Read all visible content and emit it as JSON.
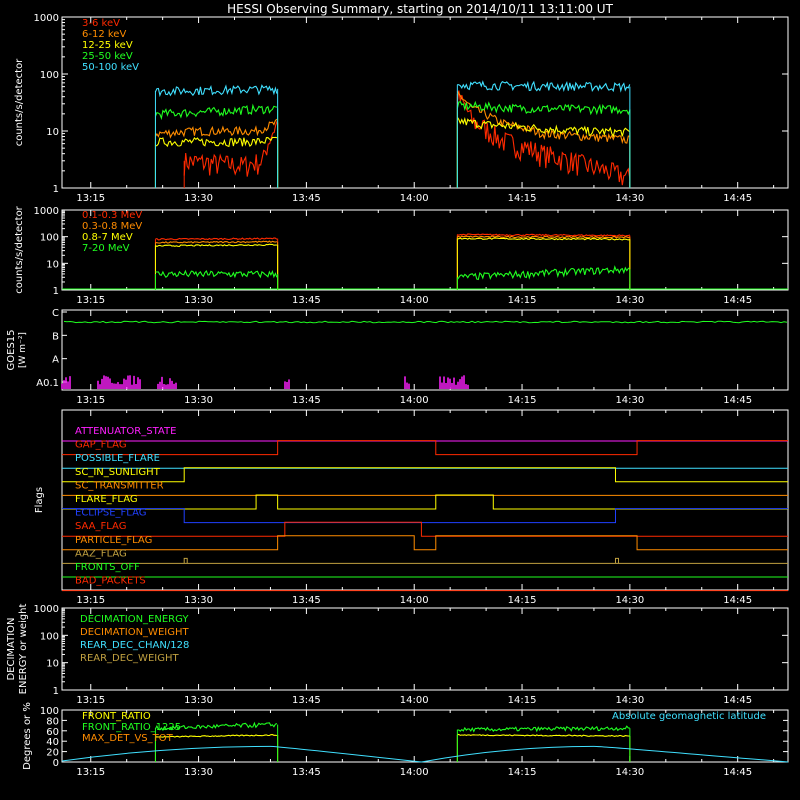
{
  "title": "HESSI Observing Summary, starting on 2014/10/11 13:11:00 UT",
  "time_ticks": [
    "13:15",
    "13:30",
    "13:45",
    "14:00",
    "14:15",
    "14:30",
    "14:45"
  ],
  "colors": {
    "red": "#ff2a00",
    "orange": "#ff8c00",
    "yellow": "#ffff00",
    "green": "#20ff20",
    "cyan": "#40e0ff",
    "magenta": "#ff20ff",
    "blue": "#2040ff",
    "olive": "#c0a040",
    "white": "#ffffff",
    "axis": "#ffffff"
  },
  "chart_data": [
    {
      "type": "line",
      "panel": "low_energy_counts",
      "ylabel": "counts/s/detector",
      "ylog": true,
      "ylim": [
        1,
        1000
      ],
      "yticks": [
        "1",
        "10",
        "100",
        "1000"
      ],
      "xlim_minutes": [
        13.183,
        14.867
      ],
      "legend": [
        "3-6 keV",
        "6-12 keV",
        "12-25 keV",
        "25-50 keV",
        "50-100 keV"
      ],
      "series": [
        {
          "name": "3-6 keV",
          "color": "red",
          "segments": [
            {
              "t": [
                "13:28",
                "13:36",
                "13:39",
                "13:40",
                "13:41"
              ],
              "y": [
                3,
                2.5,
                3,
                8,
                14
              ]
            },
            {
              "t": [
                "14:06",
                "14:08",
                "14:12",
                "14:18",
                "14:24",
                "14:30"
              ],
              "y": [
                40,
                15,
                7,
                4,
                2.5,
                1.5
              ]
            }
          ]
        },
        {
          "name": "6-12 keV",
          "color": "orange",
          "segments": [
            {
              "t": [
                "13:24",
                "13:30",
                "13:38",
                "13:41"
              ],
              "y": [
                9,
                10,
                10,
                14
              ]
            },
            {
              "t": [
                "14:06",
                "14:08",
                "14:12",
                "14:18",
                "14:24",
                "14:30"
              ],
              "y": [
                45,
                25,
                14,
                9,
                8,
                7
              ]
            }
          ]
        },
        {
          "name": "12-25 keV",
          "color": "yellow",
          "segments": [
            {
              "t": [
                "13:24",
                "13:30",
                "13:38",
                "13:41"
              ],
              "y": [
                6.5,
                6.5,
                6.5,
                7
              ]
            },
            {
              "t": [
                "14:06",
                "14:10",
                "14:18",
                "14:24",
                "14:30"
              ],
              "y": [
                15,
                13,
                11,
                10,
                9.5
              ]
            }
          ]
        },
        {
          "name": "25-50 keV",
          "color": "green",
          "segments": [
            {
              "t": [
                "13:24",
                "13:32",
                "13:41"
              ],
              "y": [
                20,
                22,
                25
              ]
            },
            {
              "t": [
                "14:06",
                "14:15",
                "14:30"
              ],
              "y": [
                28,
                25,
                24
              ]
            }
          ]
        },
        {
          "name": "50-100 keV",
          "color": "cyan",
          "segments": [
            {
              "t": [
                "13:24",
                "13:32",
                "13:41"
              ],
              "y": [
                50,
                52,
                55
              ]
            },
            {
              "t": [
                "14:06",
                "14:15",
                "14:30"
              ],
              "y": [
                65,
                62,
                60
              ]
            }
          ]
        }
      ]
    },
    {
      "type": "line",
      "panel": "high_energy_counts",
      "ylabel": "counts/s/detector",
      "ylog": true,
      "ylim": [
        1,
        1000
      ],
      "yticks": [
        "1",
        "10",
        "100",
        "1000"
      ],
      "legend": [
        "0.1-0.3 MeV",
        "0.3-0.8 MeV",
        "0.8-7 MeV",
        "7-20 MeV"
      ],
      "series": [
        {
          "name": "0.1-0.3 MeV",
          "color": "red",
          "segments": [
            {
              "t": [
                "13:24",
                "13:41"
              ],
              "y": [
                80,
                85
              ]
            },
            {
              "t": [
                "14:06",
                "14:30"
              ],
              "y": [
                120,
                110
              ]
            }
          ]
        },
        {
          "name": "0.3-0.8 MeV",
          "color": "orange",
          "segments": [
            {
              "t": [
                "13:24",
                "13:41"
              ],
              "y": [
                60,
                65
              ]
            },
            {
              "t": [
                "14:06",
                "14:30"
              ],
              "y": [
                100,
                95
              ]
            }
          ]
        },
        {
          "name": "0.8-7 MeV",
          "color": "yellow",
          "segments": [
            {
              "t": [
                "13:24",
                "13:41"
              ],
              "y": [
                45,
                50
              ]
            },
            {
              "t": [
                "14:06",
                "14:30"
              ],
              "y": [
                85,
                80
              ]
            }
          ]
        },
        {
          "name": "7-20 MeV",
          "color": "green",
          "segments": [
            {
              "t": [
                "13:24",
                "13:41"
              ],
              "y": [
                4,
                4
              ]
            },
            {
              "t": [
                "14:06",
                "14:15",
                "14:30"
              ],
              "y": [
                3,
                4,
                6
              ]
            }
          ]
        }
      ]
    },
    {
      "type": "line",
      "panel": "goes",
      "ylabel": "GOES15",
      "ylabel2": "[W m⁻²]",
      "yticks": [
        "A0.1",
        "A",
        "B",
        "C"
      ],
      "series": [
        {
          "name": "",
          "color": "green",
          "level": 0.88
        },
        {
          "name": "",
          "color": "magenta",
          "bars": true
        }
      ]
    },
    {
      "type": "table",
      "panel": "flags",
      "ylabel": "Flags",
      "flags": [
        {
          "name": "ATTENUATOR_STATE",
          "color": "magenta",
          "states": [
            0
          ]
        },
        {
          "name": "GAP_FLAG",
          "color": "red",
          "changes": [
            "13:41",
            "14:03",
            "14:31"
          ],
          "states": [
            0,
            1,
            0,
            1
          ]
        },
        {
          "name": "POSSIBLE_FLARE",
          "color": "cyan",
          "states": [
            0
          ]
        },
        {
          "name": "SC_IN_SUNLIGHT",
          "color": "yellow",
          "changes": [
            "13:28",
            "14:28"
          ],
          "states": [
            0,
            1,
            0
          ]
        },
        {
          "name": "SC_TRANSMITTER",
          "color": "orange",
          "states": [
            0
          ]
        },
        {
          "name": "FLARE_FLAG",
          "color": "yellow",
          "changes": [
            "13:38",
            "13:41",
            "14:03",
            "14:11"
          ],
          "states": [
            0,
            1,
            0,
            1,
            0
          ]
        },
        {
          "name": "ECLIPSE_FLAG",
          "color": "blue",
          "changes": [
            "13:28",
            "14:28"
          ],
          "states": [
            1,
            0,
            1
          ]
        },
        {
          "name": "SAA_FLAG",
          "color": "red",
          "changes": [
            "13:42",
            "14:01"
          ],
          "states": [
            0,
            1,
            0
          ]
        },
        {
          "name": "PARTICLE_FLAG",
          "color": "orange",
          "changes": [
            "13:41",
            "14:00",
            "14:03",
            "14:31"
          ],
          "states": [
            0,
            1,
            0,
            1,
            0
          ]
        },
        {
          "name": "AAZ_FLAG",
          "color": "olive",
          "spikes": [
            "13:28",
            "14:28"
          ]
        },
        {
          "name": "FRONTS_OFF",
          "color": "green",
          "states": [
            0
          ]
        },
        {
          "name": "BAD_PACKETS",
          "color": "red",
          "states": [
            0
          ]
        }
      ]
    },
    {
      "type": "line",
      "panel": "decimation",
      "ylabel": "DECIMATION",
      "ylabel2": "ENERGY or weight",
      "ylog": true,
      "ylim": [
        1,
        1000
      ],
      "yticks": [
        "1",
        "10",
        "100",
        "1000"
      ],
      "legend": [
        "DECIMATION_ENERGY",
        "DECIMATION_WEIGHT",
        "REAR_DEC_CHAN/128",
        "REAR_DEC_WEIGHT"
      ],
      "legend_colors": [
        "green",
        "orange",
        "cyan",
        "olive"
      ]
    },
    {
      "type": "line",
      "panel": "ratios",
      "ylabel": "Degrees or %",
      "ylim": [
        0,
        100
      ],
      "yticks": [
        "0",
        "20",
        "40",
        "60",
        "80",
        "100"
      ],
      "legend": [
        "FRONT_RATIO",
        "FRONT_RATIO_1225",
        "MAX_DET_VS_TOT"
      ],
      "legend_colors": [
        "yellow",
        "green",
        "orange"
      ],
      "annotation": "Absolute geomagnetic latitude",
      "series": [
        {
          "name": "FRONT_RATIO",
          "color": "yellow",
          "segments": [
            {
              "t": [
                "13:24",
                "13:41"
              ],
              "y": [
                48,
                52
              ]
            },
            {
              "t": [
                "14:06",
                "14:30"
              ],
              "y": [
                52,
                50
              ]
            }
          ]
        },
        {
          "name": "FRONT_RATIO_1225",
          "color": "green",
          "segments": [
            {
              "t": [
                "13:24",
                "13:41"
              ],
              "y": [
                65,
                72
              ]
            },
            {
              "t": [
                "14:06",
                "14:30"
              ],
              "y": [
                62,
                65
              ]
            }
          ]
        },
        {
          "name": "Absolute geomagnetic latitude",
          "color": "cyan",
          "segments": [
            {
              "t": [
                "13:11",
                "13:40",
                "14:01",
                "14:25",
                "14:52"
              ],
              "y": [
                2,
                30,
                0,
                30,
                0
              ]
            }
          ]
        }
      ]
    }
  ]
}
